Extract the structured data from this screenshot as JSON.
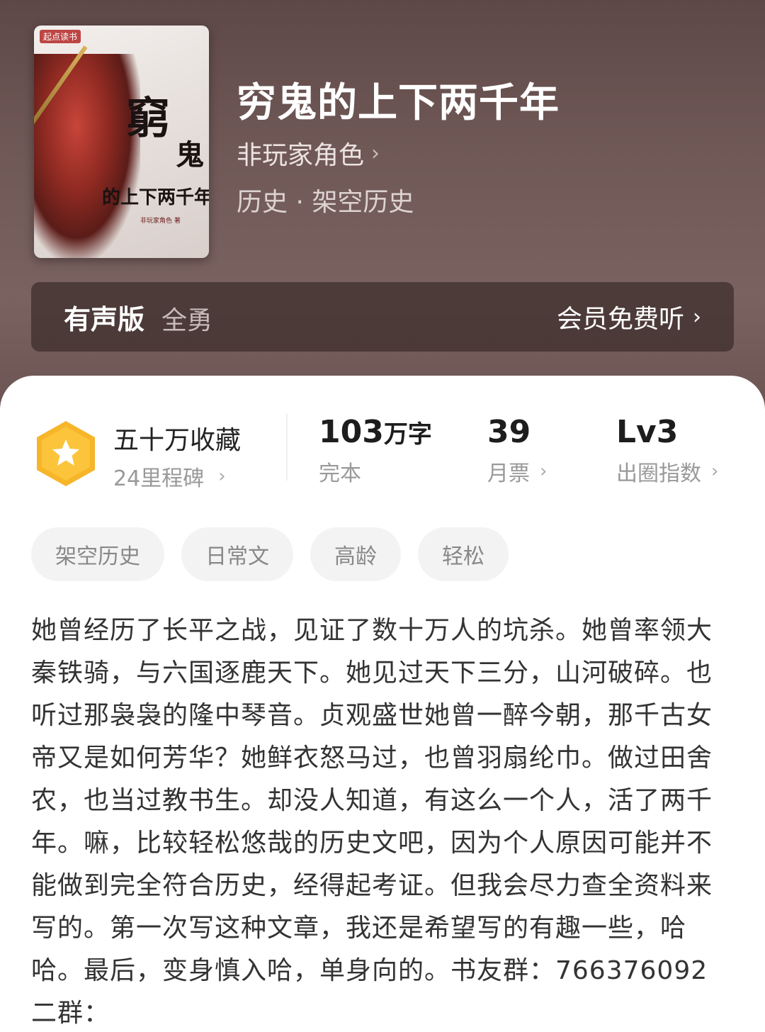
{
  "book": {
    "cover": {
      "brand": "起点读书",
      "calligraphy_1": "窮",
      "calligraphy_2": "鬼",
      "calligraphy_3": "的上下两千年",
      "author_small": "非玩家角色 著"
    },
    "title": "穷鬼的上下两千年",
    "author": "非玩家角色",
    "category": "历史 · 架空历史"
  },
  "audio": {
    "label": "有声版",
    "narrator": "全勇",
    "action": "会员免费听"
  },
  "stats": {
    "favorites": "五十万收藏",
    "milestones": "24里程碑",
    "word_count_num": "103",
    "word_count_unit": "万字",
    "status": "完本",
    "monthly_votes": "39",
    "monthly_votes_label": "月票",
    "level": "Lv3",
    "level_label": "出圈指数"
  },
  "tags": [
    "架空历史",
    "日常文",
    "高龄",
    "轻松"
  ],
  "synopsis": "她曾经历了长平之战，见证了数十万人的坑杀。她曾率领大秦铁骑，与六国逐鹿天下。她见过天下三分，山河破碎。也听过那袅袅的隆中琴音。贞观盛世她曾一醉今朝，那千古女帝又是如何芳华？她鲜衣怒马过，也曾羽扇纶巾。做过田舍农，也当过教书生。却没人知道，有这么一个人，活了两千年。嘛，比较轻松悠哉的历史文吧，因为个人原因可能并不能做到完全符合历史，经得起考证。但我会尽力查全资料来写的。第一次写这种文章，我还是希望写的有趣一些，哈哈。最后，变身慎入哈，单身向的。书友群：766376092二群：",
  "colors": {
    "header_bg": "#6f5856",
    "badge": "#f7b52a",
    "text_primary": "#333333",
    "text_muted": "#999999"
  }
}
